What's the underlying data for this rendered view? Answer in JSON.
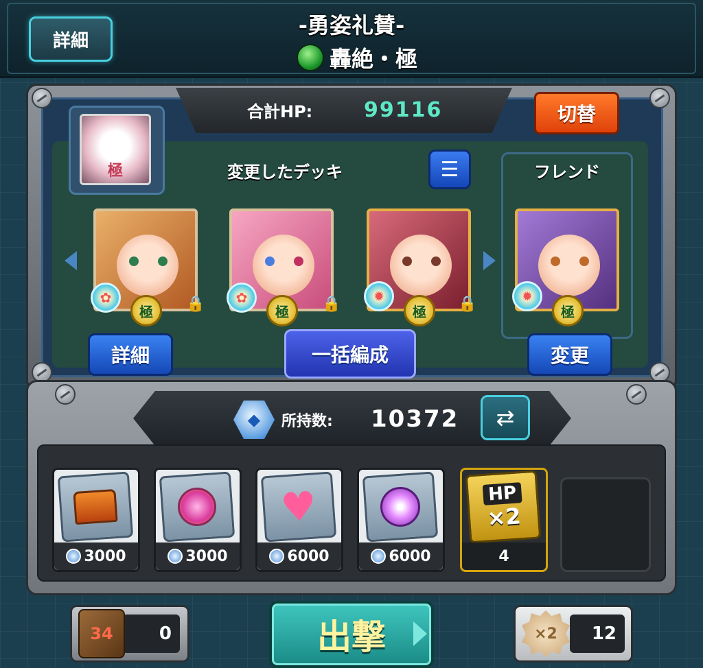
{
  "header": {
    "detail_label": "詳細",
    "quest_title": "-勇姿礼賛-",
    "quest_subtitle": "轟絶・極"
  },
  "deck": {
    "hp_label": "合計HP:",
    "hp_value": "99116",
    "switch_label": "切替",
    "deck_label": "変更したデッキ",
    "friend_label": "フレンド",
    "detail_button": "詳細",
    "bulk_button": "一括編成",
    "change_button": "変更",
    "leader_badge": "極",
    "monsters": [
      {
        "badge": "極"
      },
      {
        "badge": "極"
      },
      {
        "badge": "極"
      },
      {
        "badge": "極"
      }
    ]
  },
  "items": {
    "owned_label": "所持数:",
    "owned_value": "10372",
    "slots": [
      {
        "icon": "treasure-chest-icon",
        "cost": "3000"
      },
      {
        "icon": "pink-orb-icon",
        "cost": "3000"
      },
      {
        "icon": "heart-plus-icon",
        "cost": "6000"
      },
      {
        "icon": "purple-sparkle-icon",
        "cost": "6000"
      }
    ],
    "hp_x2": {
      "label_top": "HP",
      "label_bottom": "×2",
      "count": "4"
    }
  },
  "bottom": {
    "dice_count": "0",
    "dice_face": "34",
    "sortie_label": "出撃",
    "speed_label": "×2",
    "speed_count": "12"
  },
  "colors": {
    "hp_value": "#5fe8c6",
    "switch_button": "#e0420a",
    "blue_button": "#1548b6",
    "sortie_button": "#1a8a85"
  }
}
